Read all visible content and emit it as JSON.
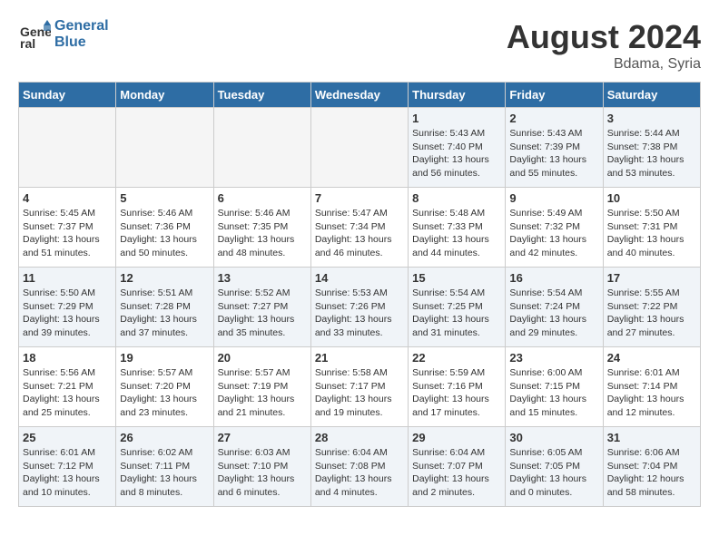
{
  "header": {
    "logo_line1": "General",
    "logo_line2": "Blue",
    "month_year": "August 2024",
    "location": "Bdama, Syria"
  },
  "weekdays": [
    "Sunday",
    "Monday",
    "Tuesday",
    "Wednesday",
    "Thursday",
    "Friday",
    "Saturday"
  ],
  "weeks": [
    [
      {
        "day": "",
        "info": ""
      },
      {
        "day": "",
        "info": ""
      },
      {
        "day": "",
        "info": ""
      },
      {
        "day": "",
        "info": ""
      },
      {
        "day": "1",
        "info": "Sunrise: 5:43 AM\nSunset: 7:40 PM\nDaylight: 13 hours\nand 56 minutes."
      },
      {
        "day": "2",
        "info": "Sunrise: 5:43 AM\nSunset: 7:39 PM\nDaylight: 13 hours\nand 55 minutes."
      },
      {
        "day": "3",
        "info": "Sunrise: 5:44 AM\nSunset: 7:38 PM\nDaylight: 13 hours\nand 53 minutes."
      }
    ],
    [
      {
        "day": "4",
        "info": "Sunrise: 5:45 AM\nSunset: 7:37 PM\nDaylight: 13 hours\nand 51 minutes."
      },
      {
        "day": "5",
        "info": "Sunrise: 5:46 AM\nSunset: 7:36 PM\nDaylight: 13 hours\nand 50 minutes."
      },
      {
        "day": "6",
        "info": "Sunrise: 5:46 AM\nSunset: 7:35 PM\nDaylight: 13 hours\nand 48 minutes."
      },
      {
        "day": "7",
        "info": "Sunrise: 5:47 AM\nSunset: 7:34 PM\nDaylight: 13 hours\nand 46 minutes."
      },
      {
        "day": "8",
        "info": "Sunrise: 5:48 AM\nSunset: 7:33 PM\nDaylight: 13 hours\nand 44 minutes."
      },
      {
        "day": "9",
        "info": "Sunrise: 5:49 AM\nSunset: 7:32 PM\nDaylight: 13 hours\nand 42 minutes."
      },
      {
        "day": "10",
        "info": "Sunrise: 5:50 AM\nSunset: 7:31 PM\nDaylight: 13 hours\nand 40 minutes."
      }
    ],
    [
      {
        "day": "11",
        "info": "Sunrise: 5:50 AM\nSunset: 7:29 PM\nDaylight: 13 hours\nand 39 minutes."
      },
      {
        "day": "12",
        "info": "Sunrise: 5:51 AM\nSunset: 7:28 PM\nDaylight: 13 hours\nand 37 minutes."
      },
      {
        "day": "13",
        "info": "Sunrise: 5:52 AM\nSunset: 7:27 PM\nDaylight: 13 hours\nand 35 minutes."
      },
      {
        "day": "14",
        "info": "Sunrise: 5:53 AM\nSunset: 7:26 PM\nDaylight: 13 hours\nand 33 minutes."
      },
      {
        "day": "15",
        "info": "Sunrise: 5:54 AM\nSunset: 7:25 PM\nDaylight: 13 hours\nand 31 minutes."
      },
      {
        "day": "16",
        "info": "Sunrise: 5:54 AM\nSunset: 7:24 PM\nDaylight: 13 hours\nand 29 minutes."
      },
      {
        "day": "17",
        "info": "Sunrise: 5:55 AM\nSunset: 7:22 PM\nDaylight: 13 hours\nand 27 minutes."
      }
    ],
    [
      {
        "day": "18",
        "info": "Sunrise: 5:56 AM\nSunset: 7:21 PM\nDaylight: 13 hours\nand 25 minutes."
      },
      {
        "day": "19",
        "info": "Sunrise: 5:57 AM\nSunset: 7:20 PM\nDaylight: 13 hours\nand 23 minutes."
      },
      {
        "day": "20",
        "info": "Sunrise: 5:57 AM\nSunset: 7:19 PM\nDaylight: 13 hours\nand 21 minutes."
      },
      {
        "day": "21",
        "info": "Sunrise: 5:58 AM\nSunset: 7:17 PM\nDaylight: 13 hours\nand 19 minutes."
      },
      {
        "day": "22",
        "info": "Sunrise: 5:59 AM\nSunset: 7:16 PM\nDaylight: 13 hours\nand 17 minutes."
      },
      {
        "day": "23",
        "info": "Sunrise: 6:00 AM\nSunset: 7:15 PM\nDaylight: 13 hours\nand 15 minutes."
      },
      {
        "day": "24",
        "info": "Sunrise: 6:01 AM\nSunset: 7:14 PM\nDaylight: 13 hours\nand 12 minutes."
      }
    ],
    [
      {
        "day": "25",
        "info": "Sunrise: 6:01 AM\nSunset: 7:12 PM\nDaylight: 13 hours\nand 10 minutes."
      },
      {
        "day": "26",
        "info": "Sunrise: 6:02 AM\nSunset: 7:11 PM\nDaylight: 13 hours\nand 8 minutes."
      },
      {
        "day": "27",
        "info": "Sunrise: 6:03 AM\nSunset: 7:10 PM\nDaylight: 13 hours\nand 6 minutes."
      },
      {
        "day": "28",
        "info": "Sunrise: 6:04 AM\nSunset: 7:08 PM\nDaylight: 13 hours\nand 4 minutes."
      },
      {
        "day": "29",
        "info": "Sunrise: 6:04 AM\nSunset: 7:07 PM\nDaylight: 13 hours\nand 2 minutes."
      },
      {
        "day": "30",
        "info": "Sunrise: 6:05 AM\nSunset: 7:05 PM\nDaylight: 13 hours\nand 0 minutes."
      },
      {
        "day": "31",
        "info": "Sunrise: 6:06 AM\nSunset: 7:04 PM\nDaylight: 12 hours\nand 58 minutes."
      }
    ]
  ]
}
